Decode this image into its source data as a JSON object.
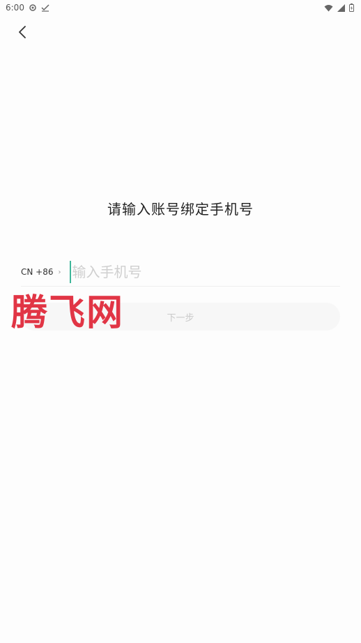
{
  "status_bar": {
    "time": "6:00",
    "icons": [
      "settings-icon",
      "check-icon",
      "wifi-icon",
      "signal-icon",
      "battery-icon"
    ]
  },
  "header": {
    "back_icon": "chevron-left-icon"
  },
  "page": {
    "title": "请输入账号绑定手机号"
  },
  "phone_form": {
    "country_code": "CN +86",
    "chevron": "›",
    "placeholder": "输入手机号",
    "value": ""
  },
  "actions": {
    "next_label": "下一步"
  },
  "watermark": {
    "text": "腾飞网",
    "color": "#e02b3c"
  },
  "colors": {
    "accent_cursor": "#3fb69a",
    "button_bg": "#f7f7f7",
    "button_text": "#c9c9c9"
  }
}
